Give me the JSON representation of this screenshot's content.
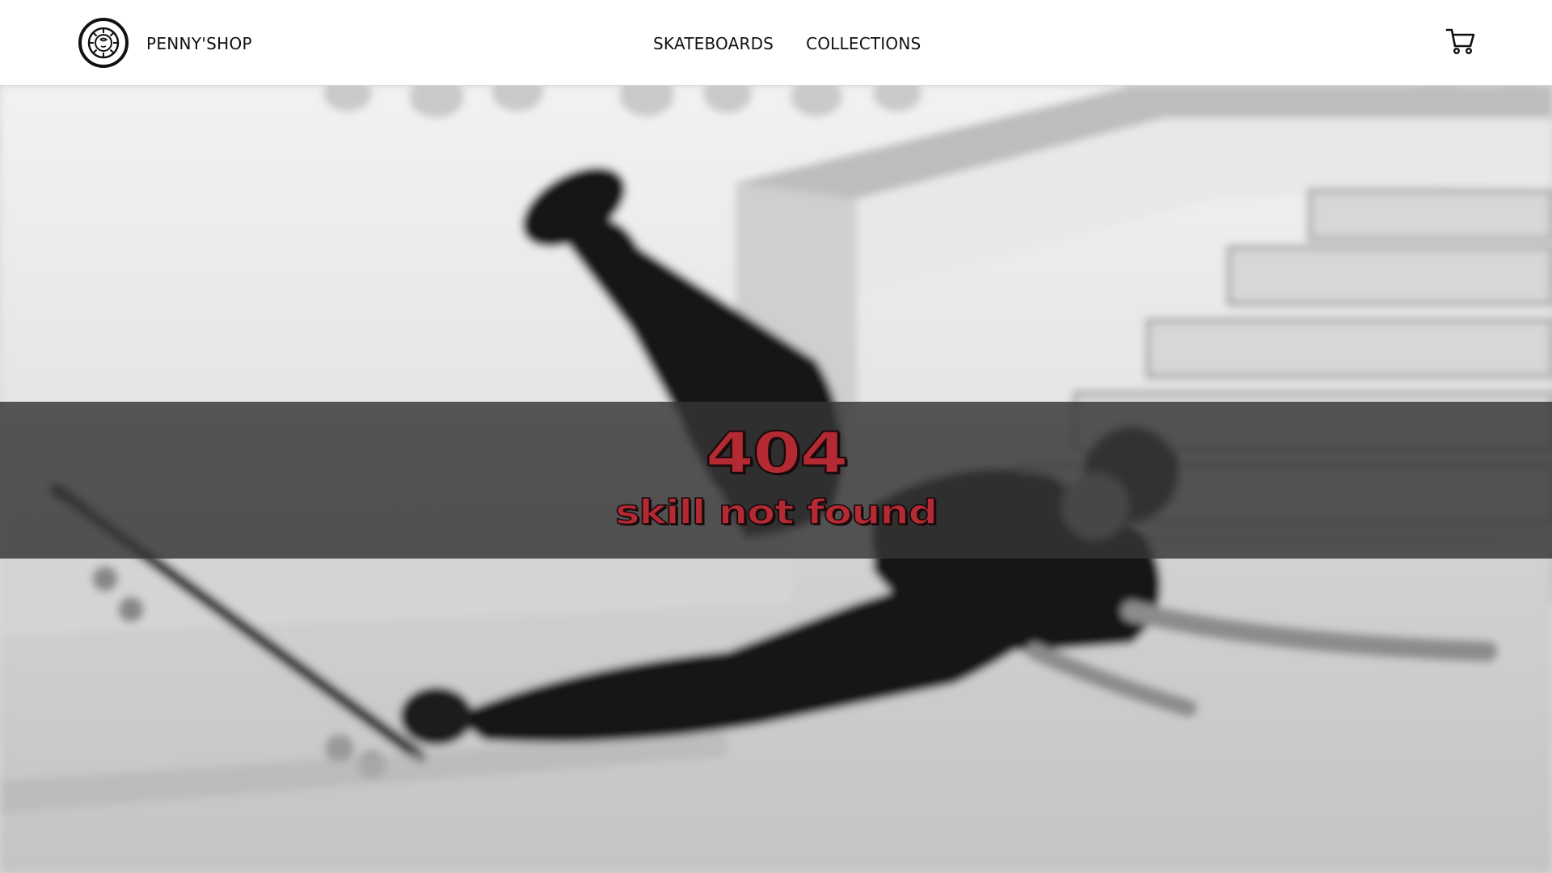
{
  "header": {
    "brand": "PENNY'SHOP",
    "logo_icon": "skate-wheel-logo-icon",
    "nav": [
      {
        "label": "SKATEBOARDS"
      },
      {
        "label": "COLLECTIONS"
      }
    ],
    "cart_icon": "shopping-cart-icon"
  },
  "error": {
    "code": "404",
    "message": "skill not found"
  },
  "colors": {
    "accent": "#b42a33",
    "banner": "#343434",
    "header_bg": "#ffffff",
    "text": "#111111"
  },
  "hero": {
    "image": "blurred black-and-white photo of a skateboarder falling in a skatepark"
  }
}
